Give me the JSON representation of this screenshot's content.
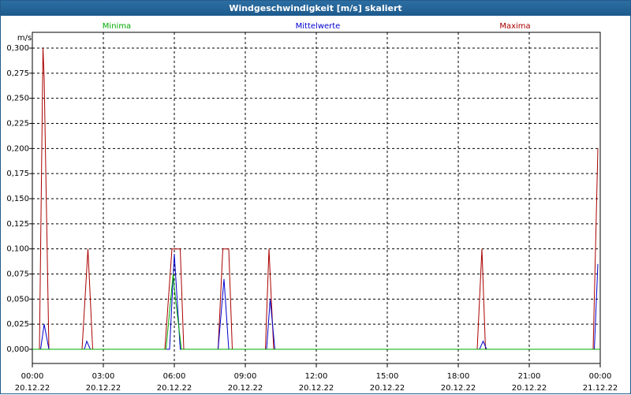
{
  "window": {
    "title": "Windgeschwindigkeit [m/s] skaliert"
  },
  "chart_data": {
    "type": "line",
    "title": "Windgeschwindigkeit [m/s] skaliert",
    "ylabel": "m/s",
    "ylim": [
      0,
      0.3
    ],
    "yticks": [
      "0,000",
      "0,025",
      "0,050",
      "0,075",
      "0,100",
      "0,125",
      "0,150",
      "0,175",
      "0,200",
      "0,225",
      "0,250",
      "0,275",
      "0,300"
    ],
    "xticks": [
      {
        "time": "00:00",
        "date": "20.12.22"
      },
      {
        "time": "03:00",
        "date": "20.12.22"
      },
      {
        "time": "06:00",
        "date": "20.12.22"
      },
      {
        "time": "09:00",
        "date": "20.12.22"
      },
      {
        "time": "12:00",
        "date": "20.12.22"
      },
      {
        "time": "15:00",
        "date": "20.12.22"
      },
      {
        "time": "18:00",
        "date": "20.12.22"
      },
      {
        "time": "21:00",
        "date": "20.12.22"
      },
      {
        "time": "00:00",
        "date": "21.12.22"
      }
    ],
    "xlim_hours": [
      0,
      24
    ],
    "grid": true,
    "legend_placement": "top",
    "series": [
      {
        "name": "Minima",
        "color": "#00aa00",
        "points": [
          [
            0,
            0
          ],
          [
            5.65,
            0
          ],
          [
            5.85,
            0.05
          ],
          [
            5.95,
            0.075
          ],
          [
            6.05,
            0.05
          ],
          [
            6.3,
            0
          ],
          [
            24,
            0
          ]
        ]
      },
      {
        "name": "Mittelwerte",
        "color": "#0000cc",
        "points": [
          [
            0,
            0
          ],
          [
            0.35,
            0
          ],
          [
            0.5,
            0.025
          ],
          [
            0.7,
            0
          ],
          [
            2.2,
            0
          ],
          [
            2.3,
            0.008
          ],
          [
            2.45,
            0
          ],
          [
            5.8,
            0
          ],
          [
            6.0,
            0.095
          ],
          [
            6.25,
            0
          ],
          [
            7.85,
            0
          ],
          [
            8.1,
            0.07
          ],
          [
            8.3,
            0
          ],
          [
            9.9,
            0
          ],
          [
            10.05,
            0.05
          ],
          [
            10.25,
            0
          ],
          [
            18.9,
            0
          ],
          [
            19.05,
            0.008
          ],
          [
            19.2,
            0
          ],
          [
            23.75,
            0
          ],
          [
            23.9,
            0.085
          ]
        ]
      },
      {
        "name": "Maxima",
        "color": "#aa0000",
        "points": [
          [
            0,
            0
          ],
          [
            0.3,
            0
          ],
          [
            0.45,
            0.3
          ],
          [
            0.5,
            0.27
          ],
          [
            0.7,
            0
          ],
          [
            2.1,
            0
          ],
          [
            2.35,
            0.1
          ],
          [
            2.55,
            0
          ],
          [
            5.6,
            0
          ],
          [
            5.9,
            0.1
          ],
          [
            6.1,
            0.1
          ],
          [
            6.25,
            0.1
          ],
          [
            6.4,
            0
          ],
          [
            7.85,
            0
          ],
          [
            8.05,
            0.1
          ],
          [
            8.3,
            0.1
          ],
          [
            8.45,
            0
          ],
          [
            9.85,
            0
          ],
          [
            10.0,
            0.1
          ],
          [
            10.2,
            0
          ],
          [
            18.8,
            0
          ],
          [
            19.0,
            0.1
          ],
          [
            19.15,
            0
          ],
          [
            23.7,
            0
          ],
          [
            23.9,
            0.2
          ]
        ]
      }
    ]
  }
}
